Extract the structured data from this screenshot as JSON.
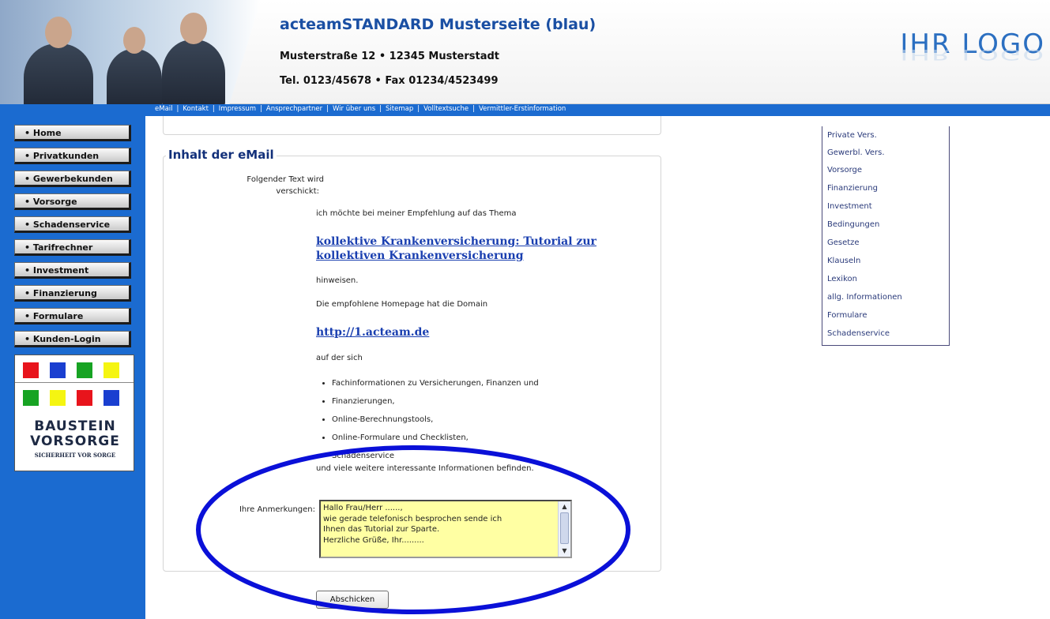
{
  "header": {
    "title": "acteamSTANDARD Musterseite (blau)",
    "address": "Musterstraße 12 • 12345 Musterstadt",
    "phone": "Tel. 0123/45678 • Fax 01234/4523499",
    "logo_text": "IHR LOGO"
  },
  "topnav": {
    "items": [
      "eMail",
      "Kontakt",
      "Impressum",
      "Ansprechpartner",
      "Wir über uns",
      "Sitemap",
      "Volltextsuche",
      "Vermittler-Erstinformation"
    ],
    "separator": "|"
  },
  "leftnav": {
    "items": [
      "• Home",
      "• Privatkunden",
      "• Gewerbekunden",
      "• Vorsorge",
      "• Schadenservice",
      "• Tarifrechner",
      "• Investment",
      "• Finanzierung",
      "• Formulare",
      "• Kunden-Login"
    ]
  },
  "banner": {
    "line1": "BAUSTEIN",
    "line2": "VORSORGE",
    "line3": "SICHERHEIT VOR SORGE",
    "colors": [
      "#e8141c",
      "#1a3fd0",
      "#17a323",
      "#f5f511",
      "#17a323",
      "#f5f511",
      "#e8141c",
      "#1a3fd0"
    ]
  },
  "main": {
    "heading": "Inhalt der eMail",
    "label_text_1": "Folgender Text wird",
    "label_text_2": "verschickt:",
    "intro": "ich möchte bei meiner Empfehlung auf das Thema",
    "topic_link_1": "kollektive Krankenversicherung: Tutorial zur",
    "topic_link_2": "kollektiven Krankenversicherung",
    "hinweisen": "hinweisen.",
    "domain_intro": "Die empfohlene Homepage hat die Domain",
    "domain_link": "http://1.acteam.de",
    "auf_der_sich": "auf der sich",
    "features": [
      "Fachinformationen zu Versicherungen, Finanzen und",
      "Finanzierungen,",
      "Online-Berechnungstools,",
      "Online-Formulare und Checklisten,",
      "Schadenservice"
    ],
    "closing": "und viele weitere interessante Informationen befinden.",
    "remarks_label": "Ihre Anmerkungen:",
    "remarks_value": "Hallo Frau/Herr ......,\nwie gerade telefonisch besprochen sende ich\nIhnen das Tutorial zur Sparte.\nHerzliche Grüße, Ihr.........",
    "submit_label": "Abschicken"
  },
  "rightmenu": {
    "items": [
      "Private Vers.",
      "Gewerbl. Vers.",
      "Vorsorge",
      "Finanzierung",
      "Investment",
      "Bedingungen",
      "Gesetze",
      "Klauseln",
      "Lexikon",
      "allg. Informationen",
      "Formulare",
      "Schadenservice"
    ]
  },
  "annotation": {
    "color": "#0a10d8"
  }
}
